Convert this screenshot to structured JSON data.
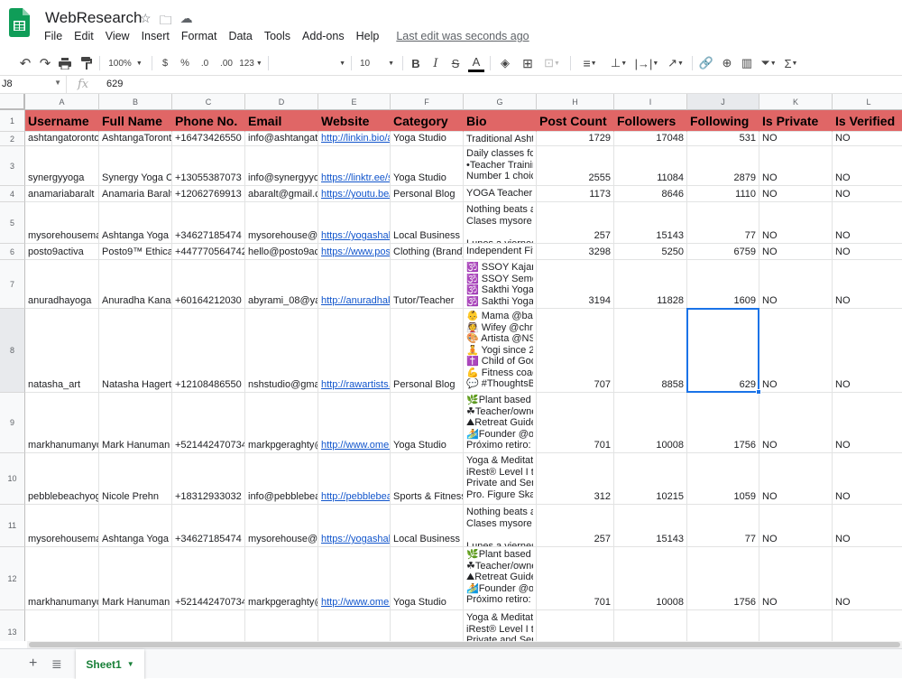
{
  "app": {
    "doc_title": "WebResearch",
    "menu": [
      "File",
      "Edit",
      "View",
      "Insert",
      "Format",
      "Data",
      "Tools",
      "Add-ons",
      "Help"
    ],
    "last_edit": "Last edit was seconds ago"
  },
  "toolbar": {
    "undo_icon": "undo-icon",
    "redo_icon": "redo-icon",
    "print_icon": "print-icon",
    "paint_icon": "paint-format-icon",
    "zoom": "100%",
    "currency": "$",
    "percent": "%",
    "dec_less": ".0",
    "dec_more": ".00",
    "format_more": "123",
    "font_size": "10",
    "bold": "B",
    "italic": "I",
    "strike": "S",
    "text_color": "A"
  },
  "formula_bar": {
    "cell_ref": "J8",
    "fx": "fx",
    "value": "629"
  },
  "columns": [
    "A",
    "B",
    "C",
    "D",
    "E",
    "F",
    "G",
    "H",
    "I",
    "J",
    "K",
    "L"
  ],
  "rows": [
    "1",
    "2",
    "3",
    "4",
    "5",
    "6",
    "7",
    "8",
    "9",
    "10",
    "11",
    "12",
    "13"
  ],
  "header_row": [
    "Username",
    "Full Name",
    "Phone No.",
    "Email",
    "Website",
    "Category",
    "Bio",
    "Post Count",
    "Followers",
    "Following",
    "Is Private",
    "Is Verified"
  ],
  "data_rows": [
    {
      "a": "ashtangatoronto",
      "b": "AshtangaToronto",
      "c": "+16473426550",
      "d": "info@ashtangatoronto",
      "e": "http://linkin.bio/a",
      "f": "Yoga Studio",
      "g": [
        "Traditional Ashta"
      ],
      "h": "1729",
      "i": "17048",
      "j": "531",
      "k": "NO",
      "l": "NO"
    },
    {
      "a": "synergyyoga",
      "b": "Synergy Yoga C",
      "c": "+13055387073",
      "d": "info@synergyyoga",
      "e": "https://linktr.ee/s",
      "f": "Yoga Studio",
      "g": [
        "Daily classes foc",
        "•Teacher Trainin",
        "Number 1 choice"
      ],
      "h": "2555",
      "i": "11084",
      "j": "2879",
      "k": "NO",
      "l": "NO"
    },
    {
      "a": "anamariabaralt",
      "b": "Anamaria Baralt",
      "c": "+12062769913",
      "d": "abaralt@gmail.c",
      "e": "https://youtu.be/l",
      "f": "Personal Blog",
      "g": [
        "YOGA Teacher |"
      ],
      "h": "1173",
      "i": "8646",
      "j": "1110",
      "k": "NO",
      "l": "NO"
    },
    {
      "a": "mysorehousema",
      "b": "Ashtanga Yoga",
      "c": "+34627185474",
      "d": "mysorehouse@",
      "e": "https://yogashala",
      "f": "Local Business",
      "g": [
        "Nothing beats a",
        "Clases mysore &",
        "",
        "Lunes a viernes"
      ],
      "h": "257",
      "i": "15143",
      "j": "77",
      "k": "NO",
      "l": "NO"
    },
    {
      "a": "posto9activa",
      "b": "Posto9™ Ethical",
      "c": "+447770564742",
      "d": "hello@posto9ac",
      "e": "https://www.post",
      "f": "Clothing (Brand)",
      "g": [
        "Independent Fitr"
      ],
      "h": "3298",
      "i": "5250",
      "j": "6759",
      "k": "NO",
      "l": "NO"
    },
    {
      "a": "anuradhayoga",
      "b": "Anuradha Kanas",
      "c": "+60164212030",
      "d": "abyrami_08@ya",
      "e": "http://anuradhak",
      "f": "Tutor/Teacher",
      "g": [
        "🕉️ SSOY Kajar",
        "🕉️ SSOY Seme",
        "🕉️ Sakthi Yoga",
        "🕉️ Sakthi Yoga"
      ],
      "h": "3194",
      "i": "11828",
      "j": "1609",
      "k": "NO",
      "l": "NO"
    },
    {
      "a": "natasha_art",
      "b": "Natasha Hagerty",
      "c": "+12108486550",
      "d": "nshstudio@gma",
      "e": "http://rawartists.",
      "f": "Personal Blog",
      "g": [
        "👶 Mama @bab",
        "👰 Wifey @chris",
        "🎨 Artista @NSH",
        "🧘 Yogi since 20",
        "✝️ Child of God",
        "💪 Fitness coac",
        "💬 #ThoughtsBy"
      ],
      "h": "707",
      "i": "8858",
      "j": "629",
      "k": "NO",
      "l": "NO"
    },
    {
      "a": "markhanumanyo",
      "b": "Mark Hanuman",
      "c": "+521442470734",
      "d": "markpgeraghty@",
      "e": "http://www.omen",
      "f": "Yoga Studio",
      "g": [
        "🌿Plant based y",
        "☘Teacher/owner",
        "⛰Retreat Guide",
        "🏄Founder @on",
        "Próximo retiro: 3"
      ],
      "h": "701",
      "i": "10008",
      "j": "1756",
      "k": "NO",
      "l": "NO"
    },
    {
      "a": "pebblebeachyog",
      "b": "Nicole Prehn",
      "c": "+18312933032",
      "d": "info@pebblebea",
      "e": "http://pebblebea",
      "f": "Sports & Fitness",
      "g": [
        "Yoga & Meditatio",
        "iRest® Level I te",
        "Private and Sem",
        "Pro. Figure Skat"
      ],
      "h": "312",
      "i": "10215",
      "j": "1059",
      "k": "NO",
      "l": "NO"
    },
    {
      "a": "mysorehousema",
      "b": "Ashtanga Yoga",
      "c": "+34627185474",
      "d": "mysorehouse@",
      "e": "https://yogashala",
      "f": "Local Business",
      "g": [
        "Nothing beats a",
        "Clases mysore &",
        "",
        "Lunes a viernes"
      ],
      "h": "257",
      "i": "15143",
      "j": "77",
      "k": "NO",
      "l": "NO"
    },
    {
      "a": "markhanumanyo",
      "b": "Mark Hanuman",
      "c": "+521442470734",
      "d": "markpgeraghty@",
      "e": "http://www.omen",
      "f": "Yoga Studio",
      "g": [
        "🌿Plant based y",
        "☘Teacher/owner",
        "⛰Retreat Guide",
        "🏄Founder @on",
        "Próximo retiro: 3"
      ],
      "h": "701",
      "i": "10008",
      "j": "1756",
      "k": "NO",
      "l": "NO"
    },
    {
      "a": "",
      "b": "",
      "c": "",
      "d": "",
      "e": "",
      "f": "",
      "g": [
        "Yoga & Meditatio",
        "iRest® Level I te",
        "Private and Sem"
      ],
      "h": "",
      "i": "",
      "j": "",
      "k": "",
      "l": ""
    }
  ],
  "sheet_tab": "Sheet1"
}
